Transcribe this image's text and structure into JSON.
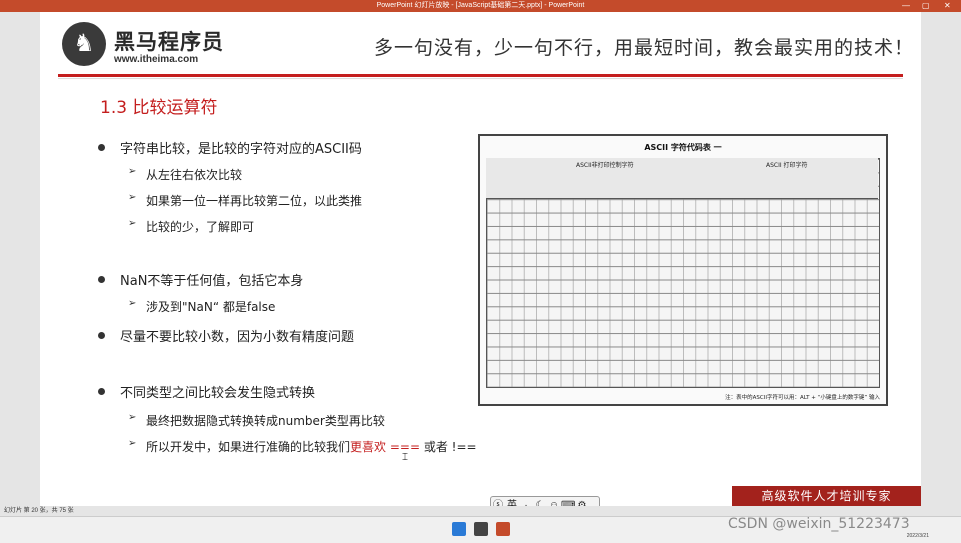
{
  "window": {
    "title": "PowerPoint 幻灯片放映 - [JavaScript基础第二天.pptx] - PowerPoint"
  },
  "slide": {
    "logo_cn": "黑马程序员",
    "logo_url": "www.itheima.com",
    "slogan": "多一句没有，少一句不行，用最短时间，教会最实用的技术！",
    "section_title": "1.3 比较运算符",
    "b1": "字符串比较，是比较的字符对应的ASCII码",
    "b1_s1": "从左往右依次比较",
    "b1_s2": "如果第一位一样再比较第二位，以此类推",
    "b1_s3": "比较的少，了解即可",
    "b2": "NaN不等于任何值，包括它本身",
    "b2_s1": "涉及到\"NaN“ 都是false",
    "b3": "尽量不要比较小数，因为小数有精度问题",
    "b4": "不同类型之间比较会发生隐式转换",
    "b4_s1": "最终把数据隐式转换转成number类型再比较",
    "b4_s2_a": "所以开发中，如果进行准确的比较我们",
    "b4_s2_b": "更喜欢 ===",
    "b4_s2_c": " 或者 !==",
    "ascii_title": "ASCII 字符代码表 一",
    "ascii_left_head": "ASCII非打印控制字符",
    "ascii_right_head": "ASCII 打印字符",
    "ascii_note": "注：表中的ASCII字符可以用：ALT + “小键盘上的数字键” 输入",
    "banner": "高级软件人才培训专家"
  },
  "ime": {
    "lang": "英"
  },
  "status": {
    "slide_info": "幻灯片 第 20 张，共 75 张"
  },
  "taskbar": {
    "date": "2022/3/21"
  },
  "watermark": "CSDN @weixin_51223473",
  "colors": {
    "accent": "#c41e1e",
    "titlebar": "#c44b2b",
    "banner": "#a3221c"
  }
}
